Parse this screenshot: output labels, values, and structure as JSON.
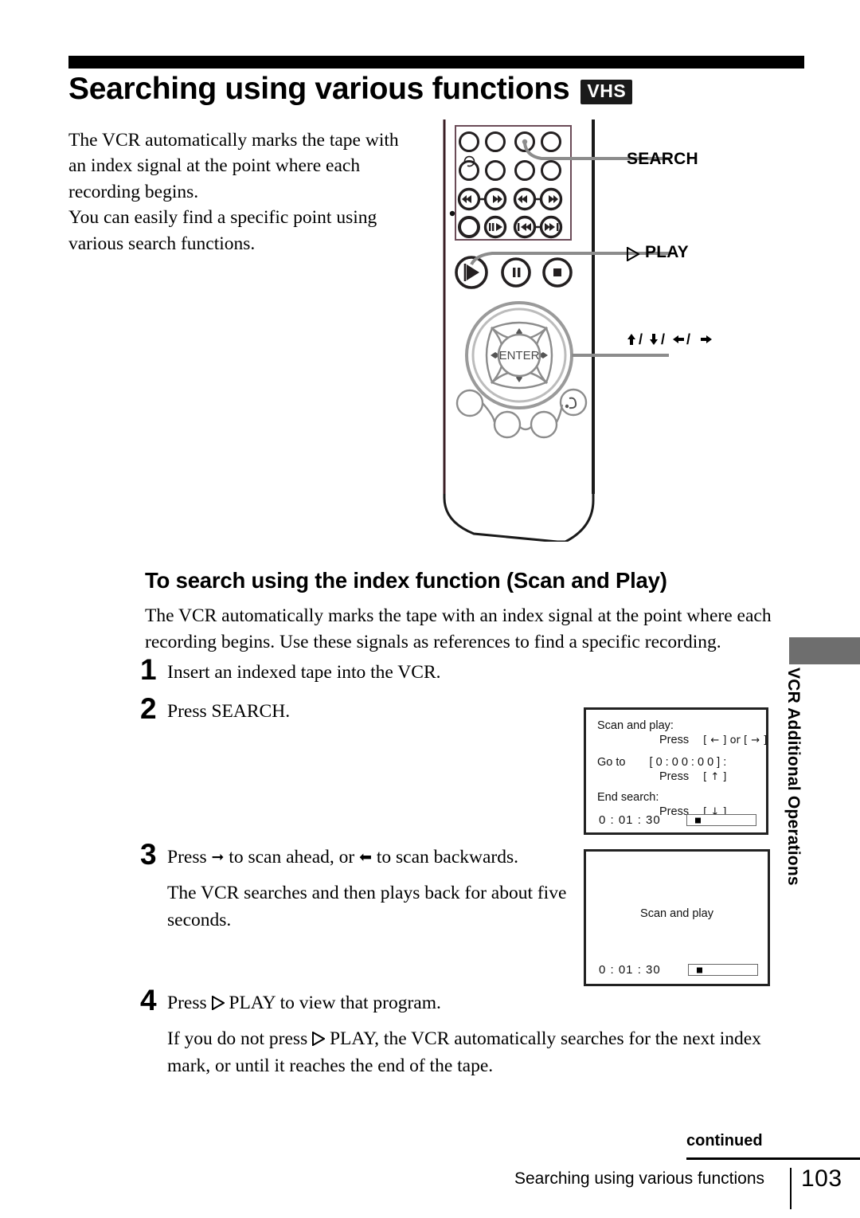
{
  "document": {
    "title": "Searching using various functions",
    "badge": "VHS"
  },
  "intro": {
    "line1": "The VCR automatically marks the tape with",
    "line2": "an index signal at the point where each",
    "line3": "recording begins.",
    "line4": "You can easily find a specific point using",
    "line5": "various search functions."
  },
  "remote": {
    "callouts": {
      "search": "SEARCH",
      "play": "PLAY",
      "arrows": "/   /   /"
    },
    "enter_label": "ENTER"
  },
  "section": {
    "heading": "To search using the index function (Scan and Play)",
    "intro_line1": "The VCR automatically marks the tape with an index signal at the point where each",
    "intro_line2": "recording begins.  Use these signals as references to find a specific recording."
  },
  "steps": [
    {
      "number": "1",
      "text": "Insert an indexed tape into the VCR."
    },
    {
      "number": "2",
      "text": "Press SEARCH."
    },
    {
      "number": "3",
      "text_a": "Press",
      "text_b": "to scan ahead, or",
      "text_c": "to scan backwards.",
      "text_d": "The VCR searches and then plays back for about five seconds."
    },
    {
      "number": "4",
      "text_a": "Press",
      "text_b": "PLAY to view that program.",
      "text_c": "If you do not press",
      "text_d": "PLAY, the VCR automatically searches for the next index mark, or until it reaches the end of the tape."
    }
  ],
  "osd_menu": {
    "line1": "Scan and play:",
    "line2_press": "Press",
    "line2_keys": "[ ← ] or [ → ]",
    "line3_label": "Go to",
    "line3_value": "[ 0 : 0 0 : 0 0 ] :",
    "line4_press": "Press",
    "line4_keys": "[ ↑ ]",
    "line5": "End search:",
    "line6_press": "Press",
    "line6_keys": "[ ↓ ]",
    "counter": "0 : 01 : 30"
  },
  "osd_playing": {
    "message": "Scan and play",
    "counter": "0 : 01 : 30"
  },
  "side_tab": {
    "label": "VCR Additional Operations",
    "color": "#6e6e6e"
  },
  "footer": {
    "continued": "continued",
    "title": "Searching using various functions",
    "page": "103"
  }
}
